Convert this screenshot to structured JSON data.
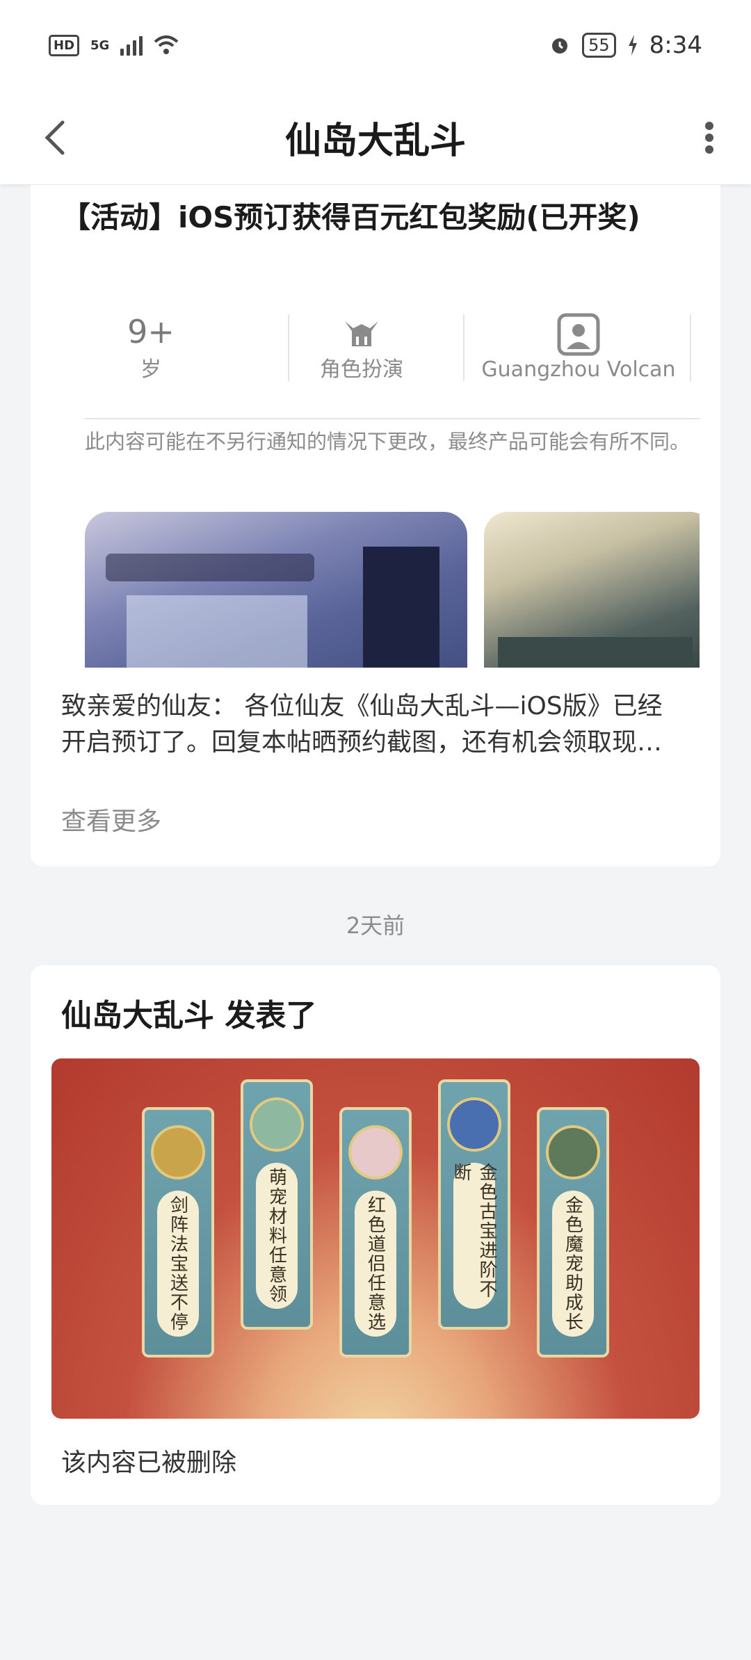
{
  "status_bar": {
    "hd": "HD",
    "network": "5G",
    "battery": "55",
    "time": "8:34"
  },
  "header": {
    "title": "仙岛大乱斗",
    "back_icon": "chevron-left-icon",
    "more_icon": "more-vertical-icon"
  },
  "post1": {
    "title": "【活动】iOS预订获得百元红包奖励(已开奖)",
    "info": {
      "age_value": "9+",
      "age_label": "岁",
      "category_label": "角色扮演",
      "developer_label": "Guangzhou Volcan"
    },
    "disclaimer": "此内容可能在不另行通知的情况下更改，最终产品可能会有所不同。",
    "excerpt": "致亲爱的仙友： 各位仙友《仙岛大乱斗—iOS版》已经开启预订了。回复本帖晒预约截图，还有机会领取现…",
    "view_more": "查看更多"
  },
  "timestamp": "2天前",
  "post2": {
    "title": "仙岛大乱斗 发表了",
    "banner_scrolls": [
      {
        "text": "剑阵法宝送不停",
        "medal_color": "#c9a44a"
      },
      {
        "text": "萌宠材料任意领",
        "medal_color": "#8fb8a0"
      },
      {
        "text": "红色道侣任意选",
        "medal_color": "#e8c9c9"
      },
      {
        "text": "金色古宝进阶不断",
        "medal_color": "#4a6fb0"
      },
      {
        "text": "金色魔宠助成长",
        "medal_color": "#5f7a5a"
      }
    ],
    "deleted_note": "该内容已被删除"
  }
}
